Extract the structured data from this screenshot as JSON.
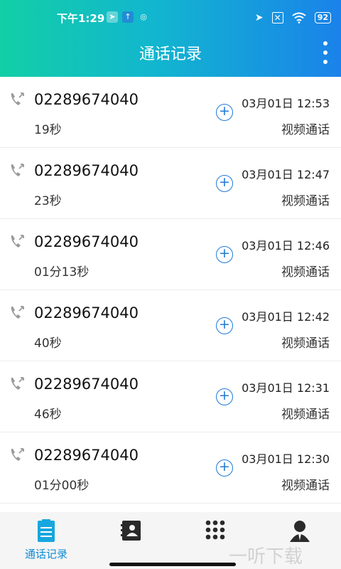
{
  "status": {
    "time": "下午1:29",
    "battery": "92"
  },
  "header": {
    "title": "通话记录"
  },
  "calls": [
    {
      "number": "02289674040",
      "duration": "19秒",
      "datetime": "03月01日 12:53",
      "type": "视频通话"
    },
    {
      "number": "02289674040",
      "duration": "23秒",
      "datetime": "03月01日 12:47",
      "type": "视频通话"
    },
    {
      "number": "02289674040",
      "duration": "01分13秒",
      "datetime": "03月01日 12:46",
      "type": "视频通话"
    },
    {
      "number": "02289674040",
      "duration": "40秒",
      "datetime": "03月01日 12:42",
      "type": "视频通话"
    },
    {
      "number": "02289674040",
      "duration": "46秒",
      "datetime": "03月01日 12:31",
      "type": "视频通话"
    },
    {
      "number": "02289674040",
      "duration": "01分00秒",
      "datetime": "03月01日 12:30",
      "type": "视频通话"
    }
  ],
  "tabs": [
    {
      "label": "通话记录",
      "icon": "list-icon"
    },
    {
      "label": "",
      "icon": "contacts-icon"
    },
    {
      "label": "",
      "icon": "dialpad-icon"
    },
    {
      "label": "",
      "icon": "profile-icon"
    }
  ],
  "watermark": "一听下载",
  "colors": {
    "accent": "#1e78d8",
    "tab_active": "#0f8bd6",
    "header_start": "#12cfa6",
    "header_end": "#1a82ea"
  }
}
